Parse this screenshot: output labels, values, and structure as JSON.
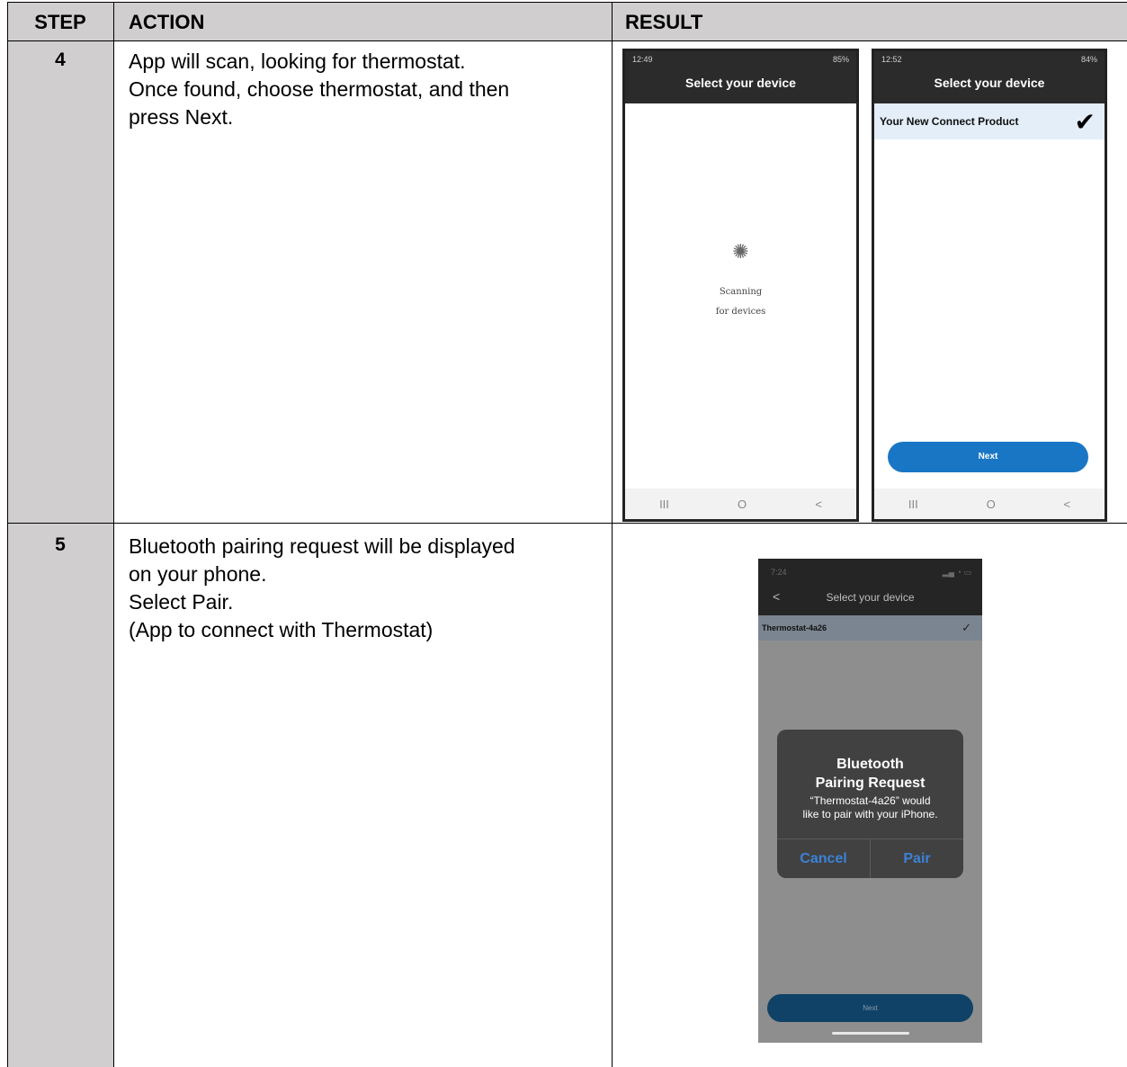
{
  "table": {
    "headers": {
      "step": "STEP",
      "action": "ACTION",
      "result": "RESULT"
    },
    "rows": [
      {
        "step": "4",
        "action_lines": [
          "App will scan, looking for thermostat.",
          "Once found, choose thermostat, and then",
          "press Next."
        ]
      },
      {
        "step": "5",
        "action_lines": [
          "Bluetooth pairing request will be displayed",
          "on your phone.",
          "Select Pair.",
          "(App to connect with Thermostat)"
        ]
      }
    ]
  },
  "screens": {
    "scanning": {
      "time": "12:49",
      "status_icons": "85%",
      "title": "Select your device",
      "spinner_icon": "spinner-icon",
      "scan_line1": "Scanning",
      "scan_line2": "for devices",
      "nav_recent": "III",
      "nav_home": "O",
      "nav_back": "<"
    },
    "found": {
      "time": "12:52",
      "status_icons": "84%",
      "title": "Select your device",
      "device_name": "Your New Connect Product",
      "check_icon": "checkmark-icon",
      "next_label": "Next",
      "nav_recent": "III",
      "nav_home": "O",
      "nav_back": "<"
    },
    "pairing": {
      "time": "7:24",
      "back_label": "<",
      "title": "Select your device",
      "device_name": "Thermostat-4a26",
      "alert_title_1": "Bluetooth",
      "alert_title_2": "Pairing Request",
      "alert_msg_1": "“Thermostat-4a26” would",
      "alert_msg_2": "like to pair with your iPhone.",
      "cancel_label": "Cancel",
      "pair_label": "Pair",
      "next_label": "Next"
    }
  }
}
